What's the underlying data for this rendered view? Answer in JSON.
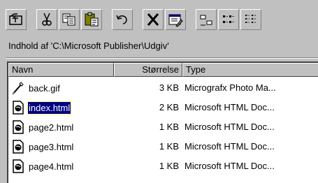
{
  "toolbar": {
    "buttons": [
      {
        "icon": "up-one-level-icon"
      },
      {
        "icon": "cut-icon"
      },
      {
        "icon": "copy-icon"
      },
      {
        "icon": "paste-icon"
      },
      {
        "icon": "undo-icon"
      },
      {
        "icon": "delete-icon"
      },
      {
        "icon": "properties-icon"
      },
      {
        "icon": "large-icons-icon"
      },
      {
        "icon": "small-icons-icon"
      },
      {
        "icon": "list-icon"
      }
    ]
  },
  "location": {
    "label": "Indhold af 'C:\\Microsoft Publisher\\Udgiv'"
  },
  "list": {
    "columns": {
      "name": "Navn",
      "size": "Størrelse",
      "type": "Type"
    },
    "rows": [
      {
        "name": "back.gif",
        "size": "3 KB",
        "type": "Micrografx Photo Ma...",
        "icon": "image-file-icon",
        "selected": false
      },
      {
        "name": "index.html",
        "size": "2 KB",
        "type": "Microsoft HTML Doc...",
        "icon": "html-file-icon",
        "selected": true
      },
      {
        "name": "page2.html",
        "size": "1 KB",
        "type": "Microsoft HTML Doc...",
        "icon": "html-file-icon",
        "selected": false
      },
      {
        "name": "page3.html",
        "size": "1 KB",
        "type": "Microsoft HTML Doc...",
        "icon": "html-file-icon",
        "selected": false
      },
      {
        "name": "page4.html",
        "size": "1 KB",
        "type": "Microsoft HTML Doc...",
        "icon": "html-file-icon",
        "selected": false
      }
    ]
  },
  "colors": {
    "face": "#c0c0c0",
    "selection": "#000080"
  }
}
